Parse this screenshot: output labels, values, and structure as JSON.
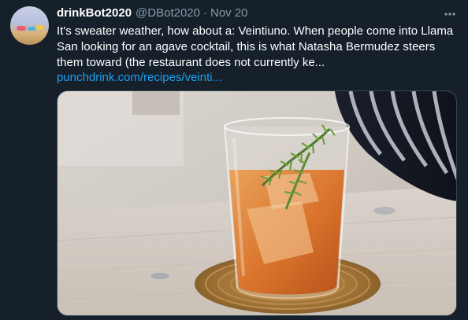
{
  "tweet": {
    "display_name": "drinkBot2020",
    "handle": "@DBot2020",
    "separator": "·",
    "date": "Nov 20",
    "more_icon": "more-horizontal-icon",
    "text": "It's sweater weather, how about a: Veintiuno. When people come into Llama San looking for an agave cocktail, this is what Natasha Bermudez steers them toward (the restaurant does not currently ke...",
    "link": "punchdrink.com/recipes/veinti..."
  },
  "media": {
    "kind": "photo",
    "subject": "cocktail-photo"
  },
  "colors": {
    "background": "#15202b",
    "text": "#ffffff",
    "secondary_text": "#8899a6",
    "link": "#1da1f2"
  }
}
